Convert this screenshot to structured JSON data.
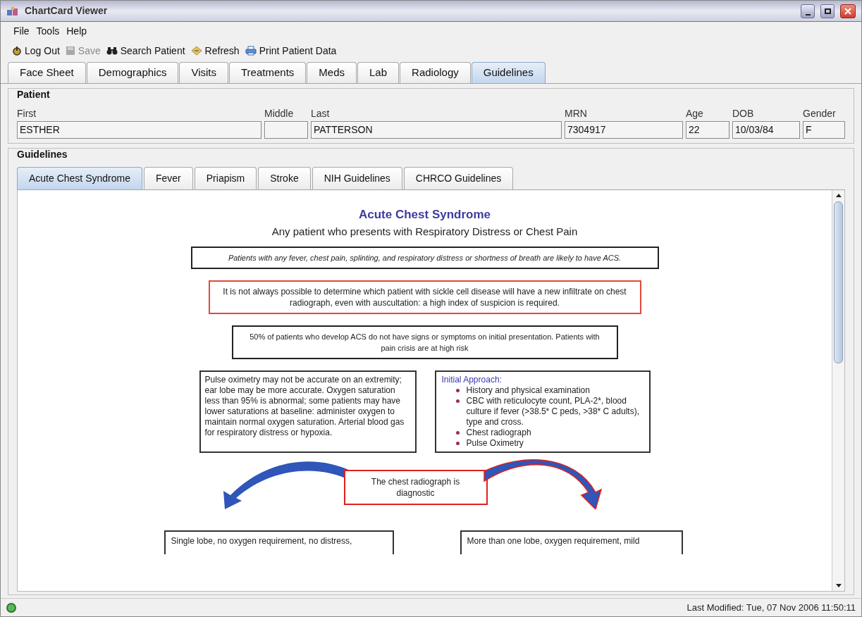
{
  "window": {
    "title": "ChartCard Viewer"
  },
  "menu": [
    "File",
    "Tools",
    "Help"
  ],
  "toolbar": [
    {
      "label": "Log Out",
      "kind": "logout",
      "disabled": false
    },
    {
      "label": "Save",
      "kind": "save",
      "disabled": true
    },
    {
      "label": "Search Patient",
      "kind": "search",
      "disabled": false
    },
    {
      "label": "Refresh",
      "kind": "refresh",
      "disabled": false
    },
    {
      "label": "Print Patient Data",
      "kind": "print",
      "disabled": false
    }
  ],
  "tabs": [
    {
      "label": "Face Sheet",
      "selected": false
    },
    {
      "label": "Demographics",
      "selected": false
    },
    {
      "label": "Visits",
      "selected": false
    },
    {
      "label": "Treatments",
      "selected": false
    },
    {
      "label": "Meds",
      "selected": false
    },
    {
      "label": "Lab",
      "selected": false
    },
    {
      "label": "Radiology",
      "selected": false
    },
    {
      "label": "Guidelines",
      "selected": true
    }
  ],
  "patient": {
    "title": "Patient",
    "fields": [
      {
        "label": "First",
        "value": "ESTHER"
      },
      {
        "label": "Middle"
      },
      {
        "label": "Last",
        "value": "PATTERSON"
      },
      {
        "label": "MRN",
        "value": "7304917"
      },
      {
        "label": "Age",
        "value": "22"
      },
      {
        "label": "DOB",
        "value": "10/03/84"
      },
      {
        "label": "Gender",
        "value": "F"
      }
    ]
  },
  "guidelines": {
    "title": "Guidelines",
    "tabs": [
      {
        "label": "Acute Chest Syndrome",
        "selected": true
      },
      {
        "label": "Fever",
        "selected": false
      },
      {
        "label": "Priapism",
        "selected": false
      },
      {
        "label": "Stroke",
        "selected": false
      },
      {
        "label": "NIH Guidelines",
        "selected": false
      },
      {
        "label": "CHRCO Guidelines",
        "selected": false
      }
    ],
    "document": {
      "title": "Acute Chest Syndrome",
      "subtitle": "Any patient who presents with Respiratory Distress or Chest Pain",
      "notes": [
        {
          "kind": "italic",
          "color": "#222222",
          "text": "Patients with any fever, chest pain, splinting, and respiratory distress or shortness of breath are likely to have ACS."
        },
        {
          "kind": "plain",
          "color": "#e04a3c",
          "text": "It is not always possible to determine which patient with sickle cell disease will have a new infiltrate on chest radiograph, even with auscultation: a high index of suspicion is required."
        },
        {
          "kind": "small",
          "color": "#222222",
          "text": "50% of patients who develop ACS do not have signs or symptoms on initial presentation. Patients with pain crisis are at high risk"
        }
      ],
      "oximetry_note": "Pulse oximetry may not be accurate on an extremity; ear lobe may be more accurate. Oxygen saturation less than 95% is abnormal; some patients may have lower saturations at baseline: administer oxygen to maintain normal oxygen saturation. Arterial blood gas for respiratory distress or hypoxia.",
      "approach": {
        "heading": "Initial Approach:",
        "items": [
          "History and physical examination",
          "CBC with reticulocyte count, PLA-2*, blood culture if fever (>38.5* C peds, >38* C adults), type and cross.",
          "Chest radiograph",
          "Pulse Oximetry"
        ]
      },
      "decision": "The chest radiograph is diagnostic",
      "outcomes": [
        "Single lobe, no oxygen requirement, no distress,",
        "More than one lobe, oxygen requirement, mild"
      ]
    }
  },
  "status_bar": {
    "text": "Last Modified: Tue, 07 Nov 2006 11:50:11"
  }
}
